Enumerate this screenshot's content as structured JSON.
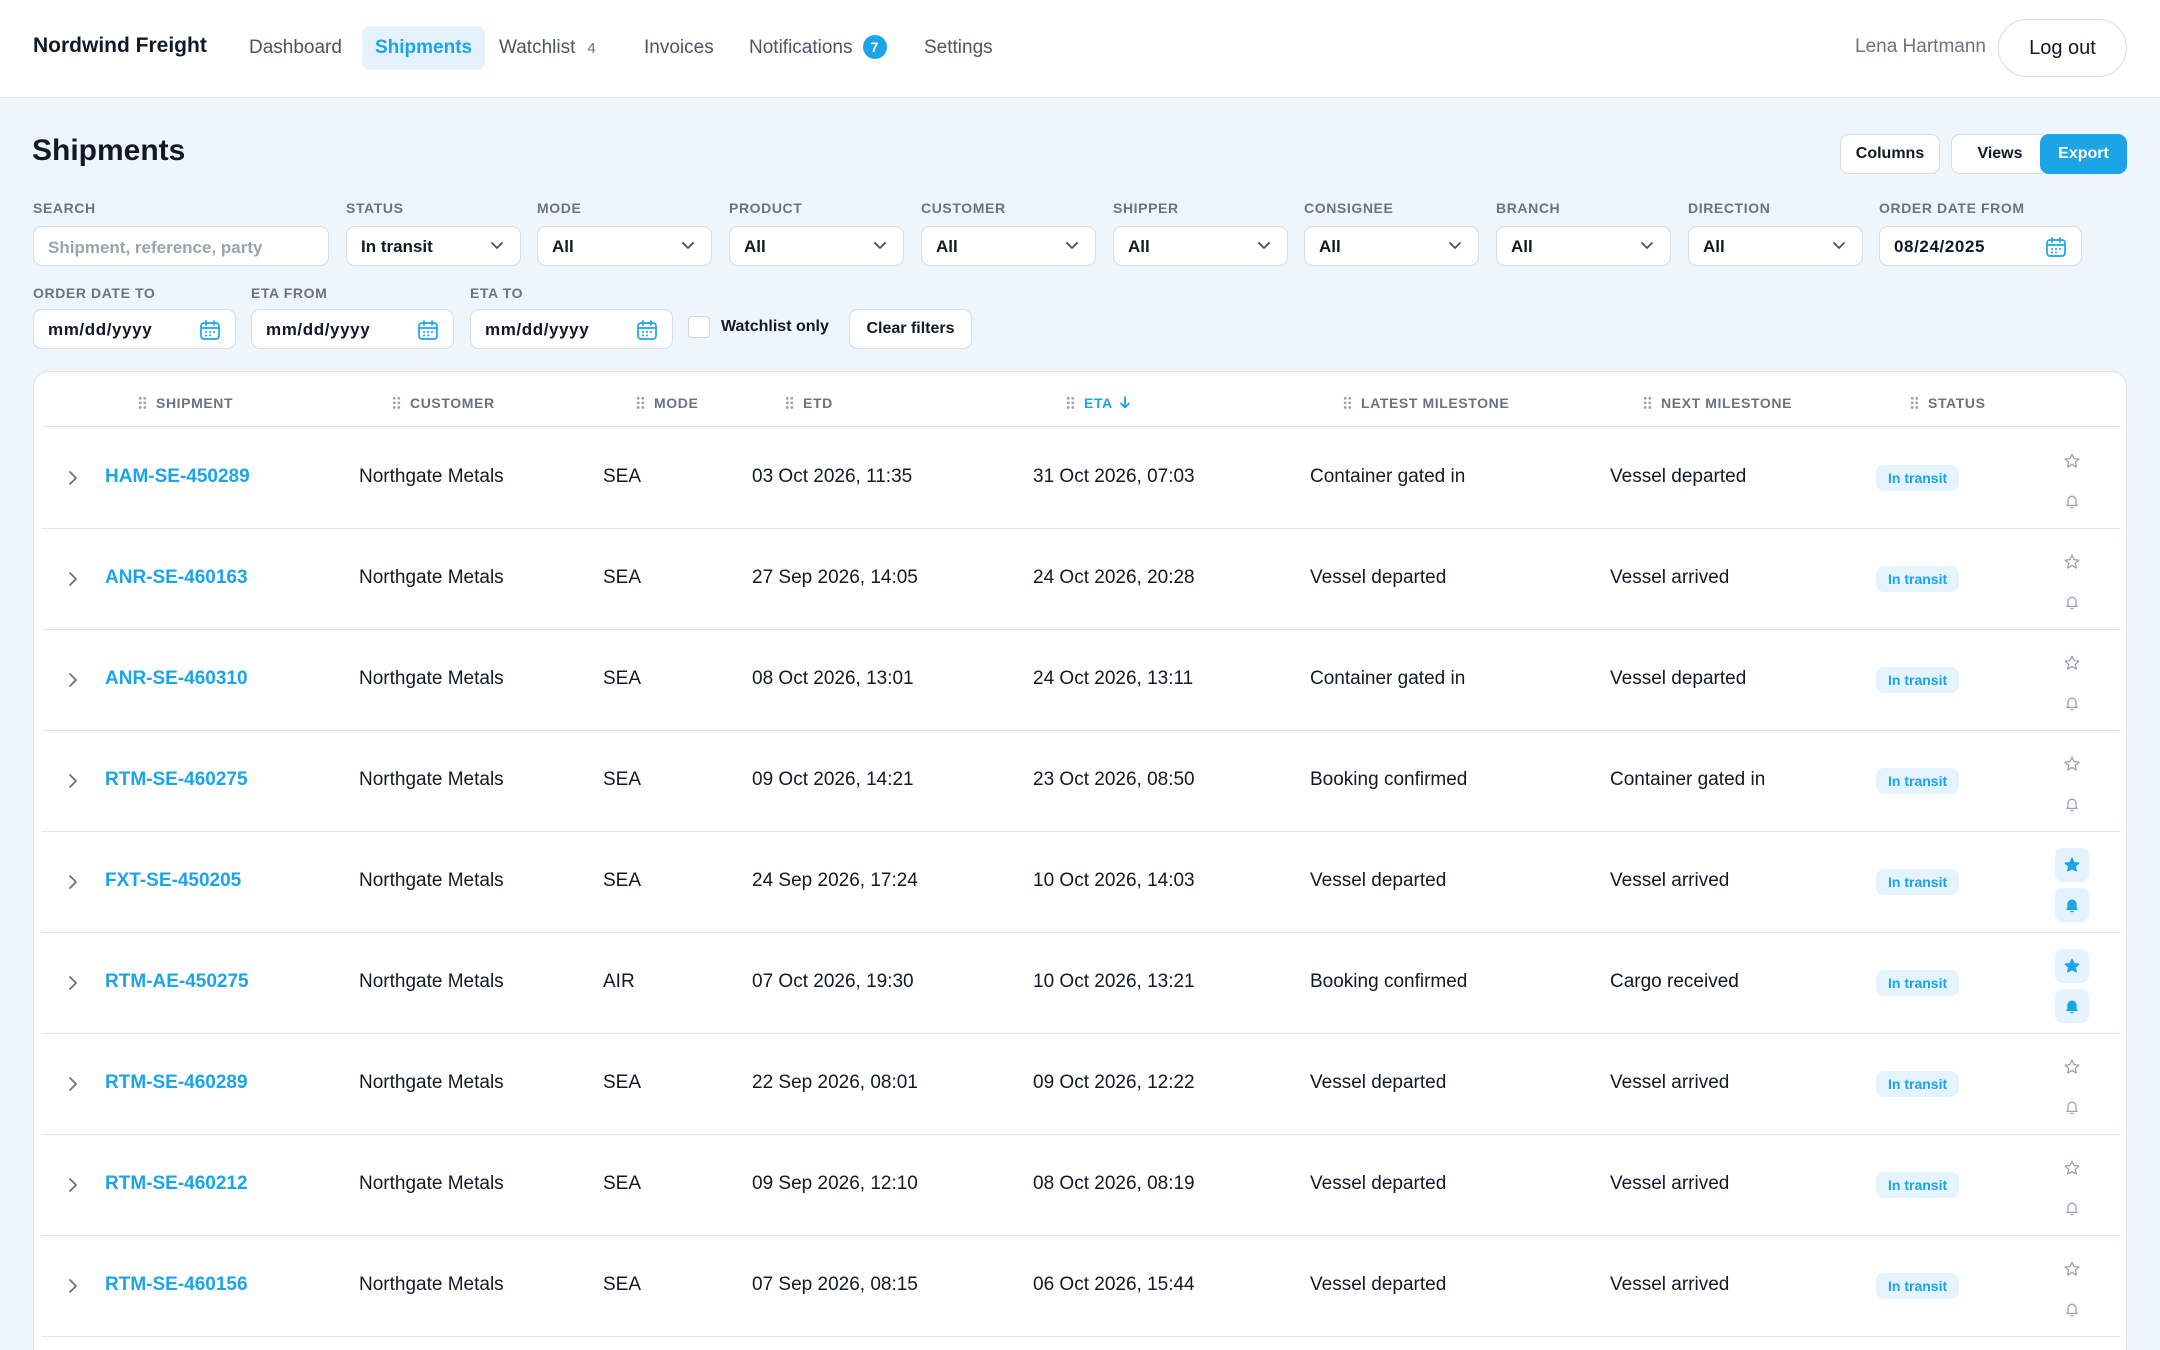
{
  "app": {
    "brand": "Nordwind Freight"
  },
  "nav": {
    "items": [
      {
        "label": "Dashboard",
        "active": false
      },
      {
        "label": "Shipments",
        "active": true
      },
      {
        "label": "Watchlist",
        "count": "4"
      },
      {
        "label": "Invoices"
      },
      {
        "label": "Notifications",
        "badge": "7"
      },
      {
        "label": "Settings"
      }
    ],
    "user": "Lena Hartmann",
    "logout_label": "Log out"
  },
  "header": {
    "title": "Shipments",
    "columns_label": "Columns",
    "views_label": "Views",
    "export_label": "Export"
  },
  "filters": {
    "search": {
      "label": "SEARCH",
      "placeholder": "Shipment, reference, party",
      "value": ""
    },
    "status": {
      "label": "STATUS",
      "value": "In transit"
    },
    "mode": {
      "label": "MODE",
      "value": "All"
    },
    "product": {
      "label": "PRODUCT",
      "value": "All"
    },
    "customer": {
      "label": "CUSTOMER",
      "value": "All"
    },
    "shipper": {
      "label": "SHIPPER",
      "value": "All"
    },
    "consignee": {
      "label": "CONSIGNEE",
      "value": "All"
    },
    "branch": {
      "label": "BRANCH",
      "value": "All"
    },
    "direction": {
      "label": "DIRECTION",
      "value": "All"
    },
    "order_date_from": {
      "label": "ORDER DATE FROM",
      "value": "08/24/2025"
    },
    "order_date_to": {
      "label": "ORDER DATE TO",
      "placeholder": "mm/dd/yyyy"
    },
    "eta_from": {
      "label": "ETA FROM",
      "placeholder": "mm/dd/yyyy"
    },
    "eta_to": {
      "label": "ETA TO",
      "placeholder": "mm/dd/yyyy"
    },
    "watchlist_only": {
      "label": "Watchlist only",
      "checked": false
    },
    "clear_label": "Clear filters"
  },
  "table": {
    "columns": [
      "SHIPMENT",
      "CUSTOMER",
      "MODE",
      "ETD",
      "ETA",
      "LATEST MILESTONE",
      "NEXT MILESTONE",
      "STATUS"
    ],
    "sorted_column": "ETA",
    "sort_direction": "descending",
    "rows": [
      {
        "shipment": "HAM-SE-450289",
        "customer": "Northgate Metals",
        "mode": "SEA",
        "etd": "03 Oct 2026, 11:35",
        "eta": "31 Oct 2026, 07:03",
        "latest": "Container gated in",
        "next": "Vessel departed",
        "status": "In transit",
        "watched": false,
        "notify": false
      },
      {
        "shipment": "ANR-SE-460163",
        "customer": "Northgate Metals",
        "mode": "SEA",
        "etd": "27 Sep 2026, 14:05",
        "eta": "24 Oct 2026, 20:28",
        "latest": "Vessel departed",
        "next": "Vessel arrived",
        "status": "In transit",
        "watched": false,
        "notify": false
      },
      {
        "shipment": "ANR-SE-460310",
        "customer": "Northgate Metals",
        "mode": "SEA",
        "etd": "08 Oct 2026, 13:01",
        "eta": "24 Oct 2026, 13:11",
        "latest": "Container gated in",
        "next": "Vessel departed",
        "status": "In transit",
        "watched": false,
        "notify": false
      },
      {
        "shipment": "RTM-SE-460275",
        "customer": "Northgate Metals",
        "mode": "SEA",
        "etd": "09 Oct 2026, 14:21",
        "eta": "23 Oct 2026, 08:50",
        "latest": "Booking confirmed",
        "next": "Container gated in",
        "status": "In transit",
        "watched": false,
        "notify": false
      },
      {
        "shipment": "FXT-SE-450205",
        "customer": "Northgate Metals",
        "mode": "SEA",
        "etd": "24 Sep 2026, 17:24",
        "eta": "10 Oct 2026, 14:03",
        "latest": "Vessel departed",
        "next": "Vessel arrived",
        "status": "In transit",
        "watched": true,
        "notify": true
      },
      {
        "shipment": "RTM-AE-450275",
        "customer": "Northgate Metals",
        "mode": "AIR",
        "etd": "07 Oct 2026, 19:30",
        "eta": "10 Oct 2026, 13:21",
        "latest": "Booking confirmed",
        "next": "Cargo received",
        "status": "In transit",
        "watched": true,
        "notify": true
      },
      {
        "shipment": "RTM-SE-460289",
        "customer": "Northgate Metals",
        "mode": "SEA",
        "etd": "22 Sep 2026, 08:01",
        "eta": "09 Oct 2026, 12:22",
        "latest": "Vessel departed",
        "next": "Vessel arrived",
        "status": "In transit",
        "watched": false,
        "notify": false
      },
      {
        "shipment": "RTM-SE-460212",
        "customer": "Northgate Metals",
        "mode": "SEA",
        "etd": "09 Sep 2026, 12:10",
        "eta": "08 Oct 2026, 08:19",
        "latest": "Vessel departed",
        "next": "Vessel arrived",
        "status": "In transit",
        "watched": false,
        "notify": false
      },
      {
        "shipment": "RTM-SE-460156",
        "customer": "Northgate Metals",
        "mode": "SEA",
        "etd": "07 Sep 2026, 08:15",
        "eta": "06 Oct 2026, 15:44",
        "latest": "Vessel departed",
        "next": "Vessel arrived",
        "status": "In transit",
        "watched": false,
        "notify": false
      }
    ]
  },
  "icons": {
    "chevron": "chevron-down-icon",
    "calendar": "calendar-icon",
    "expand": "chevron-right-icon",
    "watch": "star-icon",
    "notify": "bell-icon",
    "sort": "arrow-down-icon",
    "drag": "drag-handle-icon"
  },
  "colors": {
    "accent": "#1ca4e8",
    "page_bg": "#eef6fc",
    "muted": "#6b7280"
  }
}
